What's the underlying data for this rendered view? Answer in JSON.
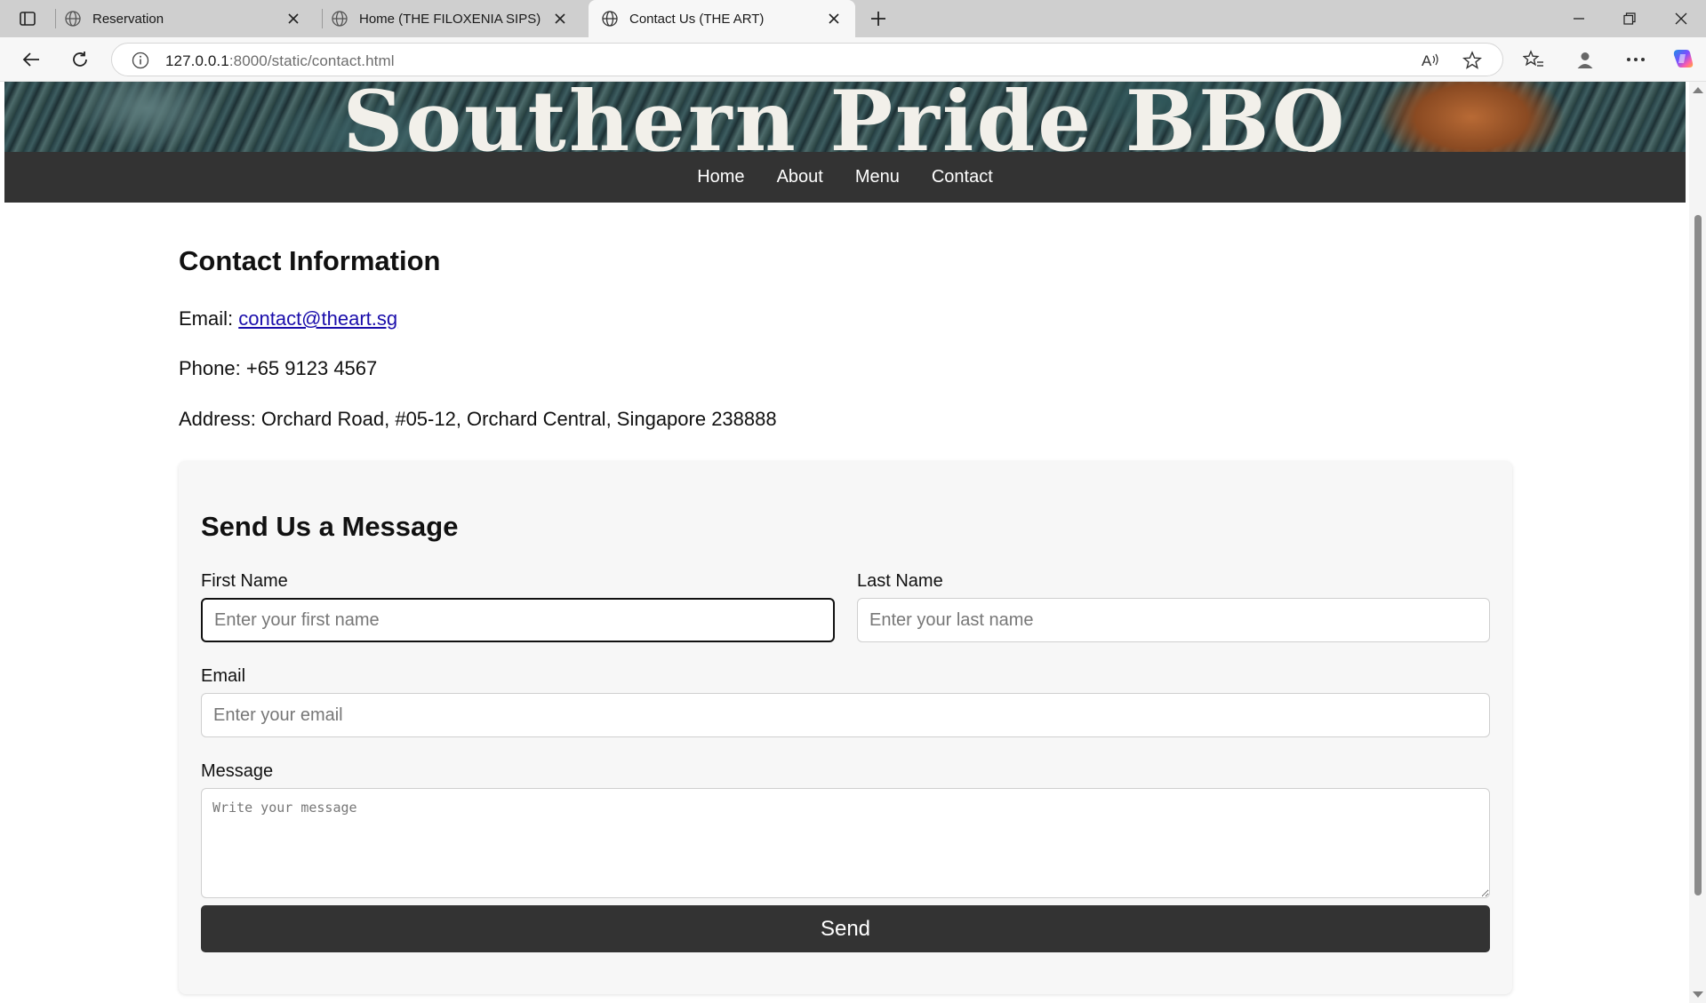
{
  "browser": {
    "tabs": [
      {
        "title": "Reservation",
        "active": false
      },
      {
        "title": "Home (THE FILOXENIA SIPS)",
        "active": false
      },
      {
        "title": "Contact Us (THE ART)",
        "active": true
      }
    ],
    "url_host": "127.0.0.1",
    "url_rest": ":8000/static/contact.html",
    "icons": [
      "sidebar-toggle-icon",
      "globe-icon",
      "close-icon",
      "plus-icon",
      "minimize-icon",
      "restore-icon",
      "back-icon",
      "refresh-icon",
      "info-icon",
      "read-aloud-icon",
      "star-icon",
      "favorites-icon",
      "profile-icon",
      "more-icon",
      "copilot-icon"
    ]
  },
  "banner": {
    "title": "Southern Pride BBQ"
  },
  "nav": {
    "items": [
      "Home",
      "About",
      "Menu",
      "Contact"
    ]
  },
  "contact": {
    "heading": "Contact Information",
    "email_label": "Email: ",
    "email_value": "contact@theart.sg",
    "phone": "Phone: +65 9123 4567",
    "address": "Address: Orchard Road, #05-12, Orchard Central, Singapore 238888"
  },
  "form": {
    "heading": "Send Us a Message",
    "first_name_label": "First Name",
    "first_name_placeholder": "Enter your first name",
    "last_name_label": "Last Name",
    "last_name_placeholder": "Enter your last name",
    "email_label": "Email",
    "email_placeholder": "Enter your email",
    "message_label": "Message",
    "message_placeholder": "Write your message",
    "send_label": "Send"
  },
  "colors": {
    "navbar": "#333333",
    "button": "#333333",
    "link": "#1a0dab",
    "card": "#f7f7f7"
  }
}
